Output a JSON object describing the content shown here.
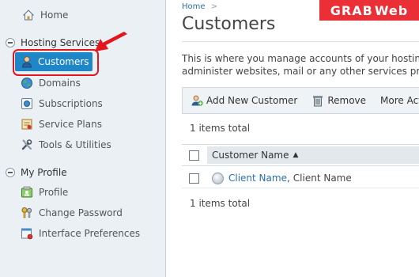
{
  "sidebar": {
    "home_label": "Home",
    "hosting_group": "Hosting Services",
    "hosting_items": [
      {
        "label": "Customers",
        "icon": "customer-icon",
        "active": true
      },
      {
        "label": "Domains",
        "icon": "globe-icon"
      },
      {
        "label": "Subscriptions",
        "icon": "subscription-icon"
      },
      {
        "label": "Service Plans",
        "icon": "service-plan-icon"
      },
      {
        "label": "Tools & Utilities",
        "icon": "tools-icon"
      }
    ],
    "profile_group": "My Profile",
    "profile_items": [
      {
        "label": "Profile",
        "icon": "profile-card-icon"
      },
      {
        "label": "Change Password",
        "icon": "keys-icon"
      },
      {
        "label": "Interface Preferences",
        "icon": "preferences-icon"
      }
    ]
  },
  "main": {
    "breadcrumb_home": "Home",
    "breadcrumb_sep": ">",
    "title": "Customers",
    "description_line1": "This is where you manage accounts of your hosting",
    "description_line2": "administer websites, mail or any other services pro",
    "toolbar": {
      "add_label": "Add New Customer",
      "remove_label": "Remove",
      "more_label": "More Act"
    },
    "items_total_top": "1 items total",
    "items_total_bottom": "1 items total",
    "column_header": "Customer Name",
    "sort_glyph": "▲",
    "rows": [
      {
        "name_link": "Client Name",
        "separator": ",",
        "name_extra": "Client Name"
      }
    ]
  },
  "watermark": {
    "part1": "GRAB",
    "part2": "Web"
  },
  "colors": {
    "accent": "#1f86c8",
    "highlight": "#e4151c",
    "link": "#2a6fb0",
    "watermark_bg": "#ea2f37"
  }
}
